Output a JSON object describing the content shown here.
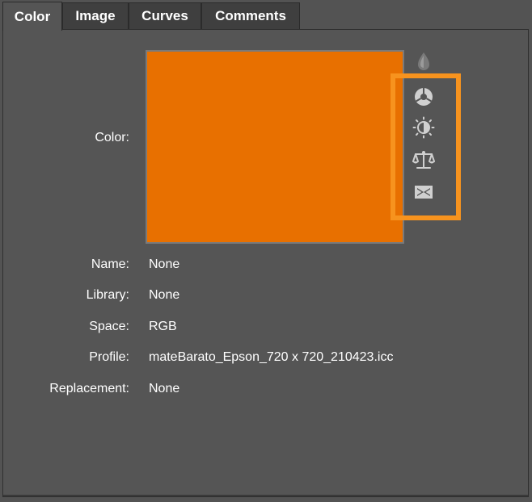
{
  "tabs": [
    {
      "label": "Color",
      "active": true
    },
    {
      "label": "Image",
      "active": false
    },
    {
      "label": "Curves",
      "active": false
    },
    {
      "label": "Comments",
      "active": false
    }
  ],
  "color": {
    "label": "Color:",
    "swatch_hex": "#e87000"
  },
  "properties": {
    "name": {
      "label": "Name:",
      "value": "None"
    },
    "library": {
      "label": "Library:",
      "value": "None"
    },
    "space": {
      "label": "Space:",
      "value": "RGB"
    },
    "profile": {
      "label": "Profile:",
      "value": "mateBarato_Epson_720 x 720_210423.icc"
    },
    "replacement": {
      "label": "Replacement:",
      "value": "None"
    }
  },
  "icons": [
    "drop-icon",
    "color-wheel-icon",
    "brightness-contrast-icon",
    "balance-scale-icon",
    "envelope-icon"
  ],
  "colors": {
    "background": "#535353",
    "tab_inactive": "#3f3f3f",
    "highlight": "#f7931e",
    "icon": "#d0d0d0",
    "icon_disabled": "#7a7a7a"
  }
}
